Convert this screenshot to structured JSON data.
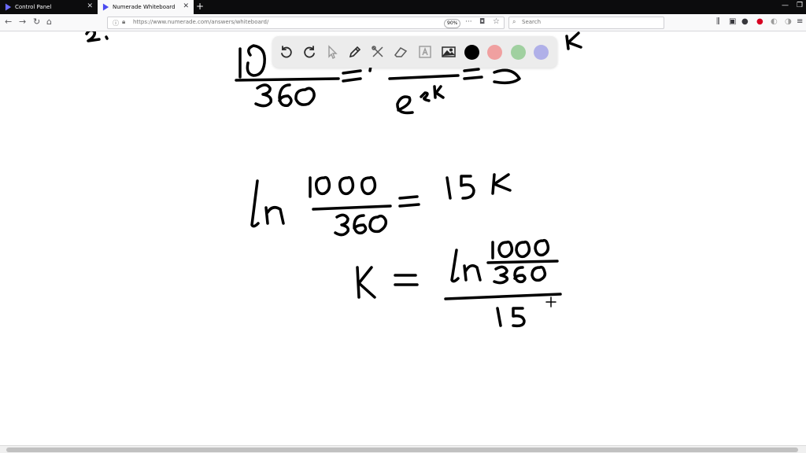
{
  "tabs": [
    {
      "label": "Control Panel",
      "active": false
    },
    {
      "label": "Numerade Whiteboard",
      "active": true
    }
  ],
  "address": {
    "url": "https://www.numerade.com/answers/whiteboard/",
    "zoom": "90%"
  },
  "search": {
    "placeholder": "Search"
  },
  "toolbar": {
    "tools": [
      "undo-icon",
      "redo-icon",
      "pointer-icon",
      "pen-icon",
      "tools-icon",
      "eraser-icon",
      "text-icon",
      "image-icon"
    ],
    "colors": [
      "#000000",
      "#f0a0a0",
      "#a0d0a0",
      "#b0b0e8"
    ]
  },
  "accent": "#0c0c0d"
}
